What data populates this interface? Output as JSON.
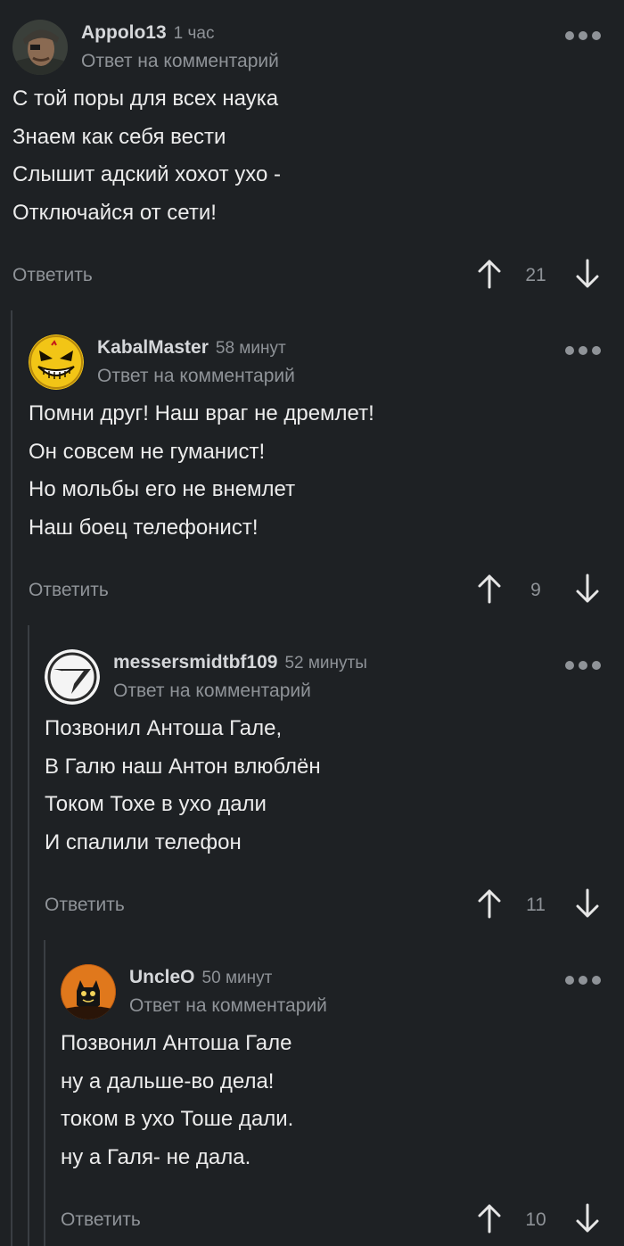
{
  "comments": [
    {
      "author": "Appolo13",
      "time": "1 час",
      "reply_to": "Ответ на комментарий",
      "avatar_icon": "user-photo-avatar",
      "lines": [
        "С той поры для всех наука",
        "Знаем как себя вести",
        "Слышит адский хохот ухо -",
        "Отключайся от сети!"
      ],
      "reply_label": "Ответить",
      "score": "21"
    },
    {
      "author": "KabalMaster",
      "time": "58 минут",
      "reply_to": "Ответ на комментарий",
      "avatar_icon": "angry-smiley-avatar",
      "lines": [
        "Помни друг! Наш враг не дремлет!",
        "Он совсем не гуманист!",
        "Но мольбы его не внемлет",
        "Наш боец телефонист!"
      ],
      "reply_label": "Ответить",
      "score": "9"
    },
    {
      "author": "messersmidtbf109",
      "time": "52 минуты",
      "reply_to": "Ответ на комментарий",
      "avatar_icon": "plane-logo-avatar",
      "lines": [
        "Позвонил Антоша  Гале,",
        "В Галю наш Антон влюблён",
        "Током Тохе в ухо дали",
        "И спалили телефон"
      ],
      "reply_label": "Ответить",
      "score": "11"
    },
    {
      "author": "UncleO",
      "time": "50 минут",
      "reply_to": "Ответ на комментарий",
      "avatar_icon": "black-cat-avatar",
      "lines": [
        "Позвонил Антоша Гале",
        "ну а дальше-во дела!",
        "током в ухо Тоше дали.",
        "ну а Галя- не дала."
      ],
      "reply_label": "Ответить",
      "score": "10"
    }
  ],
  "colors": {
    "background": "#1e2124",
    "text": "#ececec",
    "muted": "#8f9398",
    "thread_line": "#3a3e43"
  }
}
